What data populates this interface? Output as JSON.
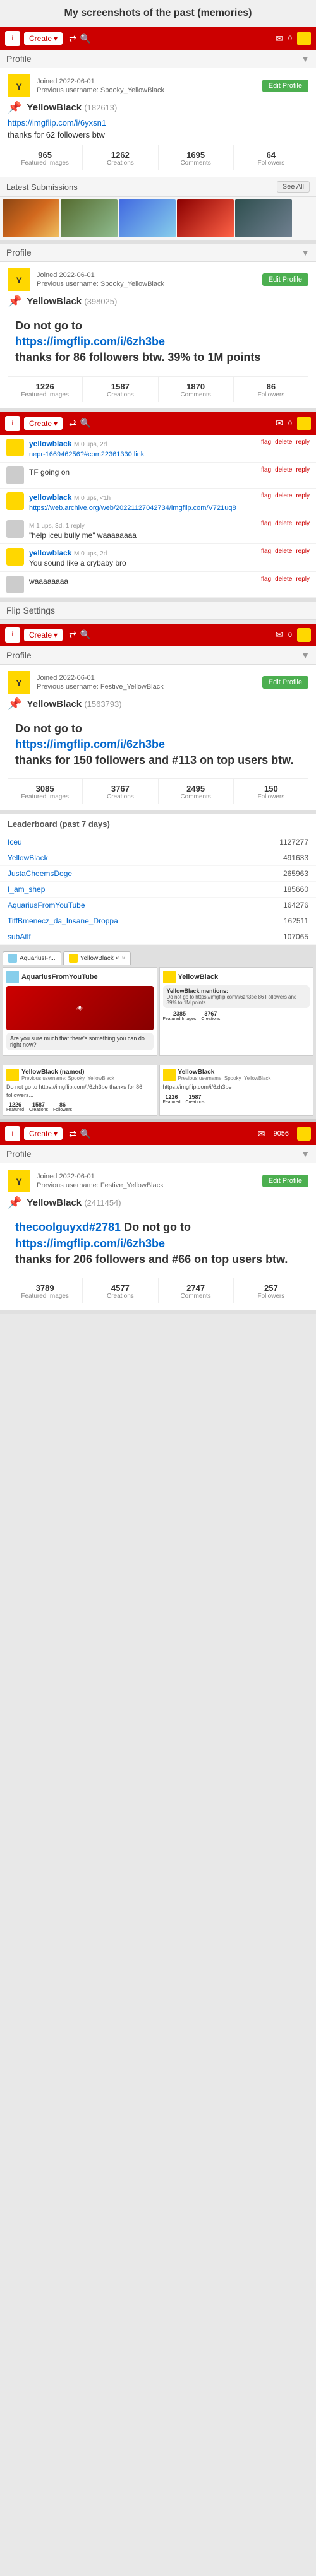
{
  "page": {
    "title": "My screenshots of the past (memories)"
  },
  "nav": {
    "logo": "i",
    "create_label": "Create",
    "num": "0",
    "icons": [
      "shuffle",
      "search",
      "mail",
      "bell"
    ]
  },
  "section1": {
    "profile_bar": "Profile",
    "username": "YellowBlack",
    "user_id": "(182613)",
    "joined": "Joined 2022-06-01",
    "prev_username": "Previous username: Spooky_YellowBlack",
    "edit_label": "Edit Profile",
    "link": "https://imgflip.com/i/6yxsn1",
    "thanks": "thanks for 62 followers btw",
    "stats": [
      {
        "num": "965",
        "label": "Featured Images"
      },
      {
        "num": "1262",
        "label": "Creations"
      },
      {
        "num": "1695",
        "label": "Comments"
      },
      {
        "num": "64",
        "label": "Followers"
      }
    ],
    "latest_label": "Latest Submissions",
    "see_all": "See All"
  },
  "section2": {
    "profile_bar": "Profile",
    "username": "YellowBlack",
    "user_id": "(398025)",
    "joined": "Joined 2022-06-01",
    "prev_username": "Previous username: Spooky_YellowBlack",
    "edit_label": "Edit Profile",
    "warning_line1": "Do not go to",
    "warning_line2": "https://imgflip.com/i/6zh3be",
    "warning_line3": "thanks for 86 followers btw. 39% to 1M points",
    "stats": [
      {
        "num": "1226",
        "label": "Featured Images"
      },
      {
        "num": "1587",
        "label": "Creations"
      },
      {
        "num": "1870",
        "label": "Comments"
      },
      {
        "num": "86",
        "label": "Followers"
      }
    ]
  },
  "section3": {
    "comments": [
      {
        "user": "yellowblack",
        "meta": "M 0 ups, 2d",
        "text": "nepr-166946256?#com22361330 link",
        "actions": [
          "flag",
          "delete",
          "reply"
        ]
      },
      {
        "user": "",
        "meta": "",
        "text": "TF going on",
        "actions": [
          "flag",
          "delete",
          "reply"
        ]
      },
      {
        "user": "yellowblack",
        "meta": "M 0 ups, <1h",
        "text": "https://web.archive.org/web/20221127042734/imgflip.com/V721uq8",
        "actions": [
          "flag",
          "delete",
          "reply"
        ]
      },
      {
        "user": "",
        "meta": "M 1 ups, 3d, 1 reply",
        "text": "\"help iceu bully me\" waaaaaaaa",
        "actions": [
          "flag",
          "delete",
          "reply"
        ]
      },
      {
        "user": "yellowblack",
        "meta": "M 0 ups, 2d",
        "text": "You sound like a crybaby bro",
        "actions": [
          "flag",
          "delete",
          "reply"
        ]
      },
      {
        "user": "",
        "meta": "",
        "text": "waaaaaaaa",
        "actions": [
          "flag",
          "delete",
          "reply"
        ]
      }
    ],
    "flip_settings": "Flip Settings"
  },
  "section4": {
    "profile_bar": "Profile",
    "username": "YellowBlack",
    "user_id": "(1563793)",
    "joined": "Joined 2022-06-01",
    "prev_username": "Previous username: Festive_YellowBlack",
    "edit_label": "Edit Profile",
    "warning_line1": "Do not go to",
    "warning_line2": "https://imgflip.com/i/6zh3be",
    "warning_line3": "thanks for 150 followers and #113 on top users btw.",
    "stats": [
      {
        "num": "3085",
        "label": "Featured Images"
      },
      {
        "num": "3767",
        "label": "Creations"
      },
      {
        "num": "2495",
        "label": "Comments"
      },
      {
        "num": "150",
        "label": "Followers"
      }
    ]
  },
  "leaderboard": {
    "title": "Leaderboard (past 7 days)",
    "rows": [
      {
        "name": "Iceu",
        "num": "1127277"
      },
      {
        "name": "YellowBlack",
        "num": "491633"
      },
      {
        "name": "JustaCheemsDoge",
        "num": "265963"
      },
      {
        "name": "I_am_shep",
        "num": "185660"
      },
      {
        "name": "AquariusFromYouTube",
        "num": "164276"
      },
      {
        "name": "TiffBmenecz_da_Insane_Droppa",
        "num": "162511"
      },
      {
        "name": "subAtlf",
        "num": "107065"
      }
    ]
  },
  "tabs_section": {
    "tabs": [
      {
        "label": "AquariusFr..."
      },
      {
        "label": "YellowBlack ×"
      }
    ],
    "left_panel": {
      "username": "AquariusFromYouTube",
      "image_label": "Spider-Man image",
      "text": "Are you sure much that there's something you can do right now?"
    },
    "right_panel": {
      "username": "YellowBlack",
      "message": "YellowBlack mentions:",
      "sub_text": "Do not go to https://imgflip.com/i/6zh3be 86 Followers and 39% to 1M points...",
      "stats": [
        {
          "num": "2385",
          "label": "Featured Images"
        },
        {
          "num": "3767",
          "label": "Creations"
        }
      ]
    }
  },
  "section5": {
    "inner_panels": [
      {
        "username": "YellowBlack (named)",
        "prev": "Previous username: Spooky_YellowBlack",
        "text": "Do not go to https://imgflip.com/i/6zh3be thanks for 86 followers...",
        "stats": [
          {
            "num": "1226",
            "label": "Featured"
          },
          {
            "num": "1587",
            "label": "Creations"
          },
          {
            "num": "86",
            "label": "Followers"
          }
        ]
      },
      {
        "username": "YellowBlack",
        "prev": "Previous username: Spooky_YellowBlack",
        "text": "https://imgflip.com/i/6zh3be",
        "stats": [
          {
            "num": "1226",
            "label": "Featured"
          },
          {
            "num": "1587",
            "label": "Creations"
          }
        ]
      }
    ]
  },
  "section6": {
    "profile_bar": "Profile",
    "username": "YellowBlack",
    "user_id": "(2411454)",
    "joined": "Joined 2022-06-01",
    "prev_username": "Previous username: Festive_YellowBlack",
    "edit_label": "Edit Profile",
    "thanks_user": "thecoolguyxd#2781",
    "warning_line1": "Do not go to",
    "warning_line2": "https://imgflip.com/i/6zh3be",
    "warning_line3": "thanks for 206 followers and #66 on top users btw.",
    "stats": [
      {
        "num": "3789",
        "label": "Featured Images"
      },
      {
        "num": "4577",
        "label": "Creations"
      },
      {
        "num": "2747",
        "label": "Comments"
      },
      {
        "num": "257",
        "label": "Followers"
      }
    ]
  }
}
